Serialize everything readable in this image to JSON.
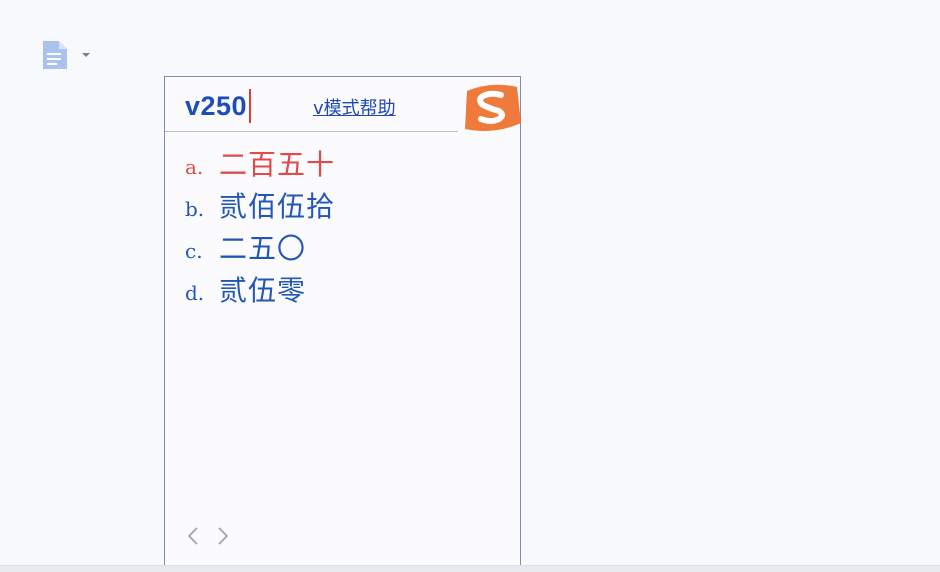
{
  "toolbar": {
    "doc_icon": "document-icon",
    "dropdown_icon": "caret-down-icon"
  },
  "ime": {
    "composition": "v250",
    "help_link": "v模式帮助",
    "logo": "sogou-logo-icon",
    "candidates": [
      {
        "key": "a.",
        "text": "二百五十",
        "state": "selected"
      },
      {
        "key": "b.",
        "text": "贰佰伍拾",
        "state": "normal"
      },
      {
        "key": "c.",
        "text": "二五〇",
        "state": "normal"
      },
      {
        "key": "d.",
        "text": "贰伍零",
        "state": "normal"
      }
    ],
    "pager": {
      "prev_icon": "chevron-left-icon",
      "next_icon": "chevron-right-icon"
    }
  },
  "colors": {
    "accent": "#1d4db8",
    "selected": "#e14a4a",
    "logo": "#f07a3c"
  }
}
